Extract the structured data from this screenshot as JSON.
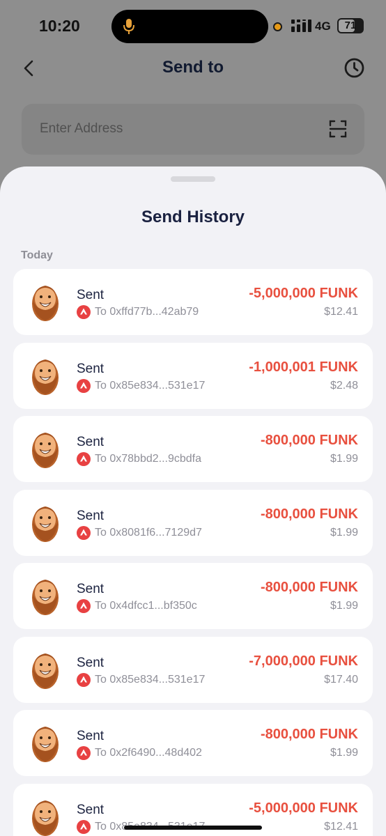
{
  "status_bar": {
    "time": "10:20",
    "network": "4G",
    "battery": "71",
    "battery_level": 0.71
  },
  "header": {
    "title": "Send to",
    "back_icon": "chevron-left-icon",
    "history_icon": "clock-icon"
  },
  "address": {
    "placeholder": "Enter Address",
    "scan_icon": "scan-icon"
  },
  "sheet": {
    "title": "Send History",
    "section_label": "Today"
  },
  "colors": {
    "accent_red": "#e8503f",
    "avalanche_red": "#e84142",
    "title_navy": "#1a2140"
  },
  "transactions": [
    {
      "type": "Sent",
      "to": "To 0xffd77b...42ab79",
      "amount": "-5,000,000 FUNK",
      "usd": "$12.41"
    },
    {
      "type": "Sent",
      "to": "To 0x85e834...531e17",
      "amount": "-1,000,001 FUNK",
      "usd": "$2.48"
    },
    {
      "type": "Sent",
      "to": "To 0x78bbd2...9cbdfa",
      "amount": "-800,000 FUNK",
      "usd": "$1.99"
    },
    {
      "type": "Sent",
      "to": "To 0x8081f6...7129d7",
      "amount": "-800,000 FUNK",
      "usd": "$1.99"
    },
    {
      "type": "Sent",
      "to": "To 0x4dfcc1...bf350c",
      "amount": "-800,000 FUNK",
      "usd": "$1.99"
    },
    {
      "type": "Sent",
      "to": "To 0x85e834...531e17",
      "amount": "-7,000,000 FUNK",
      "usd": "$17.40"
    },
    {
      "type": "Sent",
      "to": "To 0x2f6490...48d402",
      "amount": "-800,000 FUNK",
      "usd": "$1.99"
    },
    {
      "type": "Sent",
      "to": "To 0x85e834...531e17",
      "amount": "-5,000,000 FUNK",
      "usd": "$12.41"
    }
  ]
}
